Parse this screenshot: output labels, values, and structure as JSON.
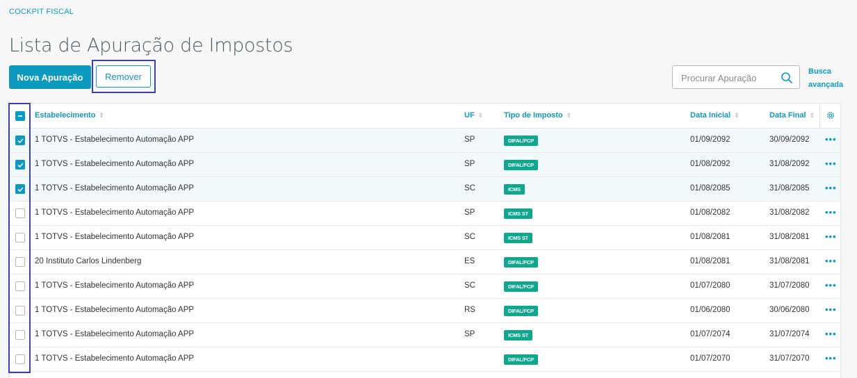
{
  "breadcrumb": "COCKPIT FISCAL",
  "title": "Lista de Apuração de Impostos",
  "toolbar": {
    "new_label": "Nova Apuração",
    "remove_label": "Remover"
  },
  "search": {
    "placeholder": "Procurar Apuração",
    "advanced_line1": "Busca",
    "advanced_line2": "avançada"
  },
  "table": {
    "headers": {
      "estab": "Estabelecimento",
      "uf": "UF",
      "tipo": "Tipo de Imposto",
      "inicio": "Data Inicial",
      "fim": "Data Final"
    },
    "rows": [
      {
        "checked": true,
        "estab": "1 TOTVS - Estabelecimento Automação APP",
        "uf": "SP",
        "tipo": "DIFAL/FCP",
        "inicio": "01/09/2092",
        "fim": "30/09/2092"
      },
      {
        "checked": true,
        "estab": "1 TOTVS - Estabelecimento Automação APP",
        "uf": "SP",
        "tipo": "DIFAL/FCP",
        "inicio": "01/08/2092",
        "fim": "31/08/2092"
      },
      {
        "checked": true,
        "estab": "1 TOTVS - Estabelecimento Automação APP",
        "uf": "SC",
        "tipo": "ICMS",
        "inicio": "01/08/2085",
        "fim": "31/08/2085"
      },
      {
        "checked": false,
        "estab": "1 TOTVS - Estabelecimento Automação APP",
        "uf": "SP",
        "tipo": "ICMS ST",
        "inicio": "01/08/2082",
        "fim": "31/08/2082"
      },
      {
        "checked": false,
        "estab": "1 TOTVS - Estabelecimento Automação APP",
        "uf": "SC",
        "tipo": "ICMS ST",
        "inicio": "01/08/2081",
        "fim": "31/08/2081"
      },
      {
        "checked": false,
        "estab": "20 Instituto Carlos Lindenberg",
        "uf": "ES",
        "tipo": "DIFAL/FCP",
        "inicio": "01/08/2081",
        "fim": "31/08/2081"
      },
      {
        "checked": false,
        "estab": "1 TOTVS - Estabelecimento Automação APP",
        "uf": "SC",
        "tipo": "DIFAL/FCP",
        "inicio": "01/07/2080",
        "fim": "31/07/2080"
      },
      {
        "checked": false,
        "estab": "1 TOTVS - Estabelecimento Automação APP",
        "uf": "RS",
        "tipo": "DIFAL/FCP",
        "inicio": "01/06/2080",
        "fim": "30/06/2080"
      },
      {
        "checked": false,
        "estab": "1 TOTVS - Estabelecimento Automação APP",
        "uf": "SP",
        "tipo": "ICMS ST",
        "inicio": "01/07/2074",
        "fim": "31/07/2074"
      },
      {
        "checked": false,
        "estab": "1 TOTVS - Estabelecimento Automação APP",
        "uf": "",
        "tipo": "DIFAL/FCP",
        "inicio": "01/07/2070",
        "fim": "31/07/2070"
      }
    ]
  },
  "colors": {
    "accent": "#0c9abe",
    "badge": "#0fa88f",
    "highlight_frame": "#3a3fb8"
  }
}
